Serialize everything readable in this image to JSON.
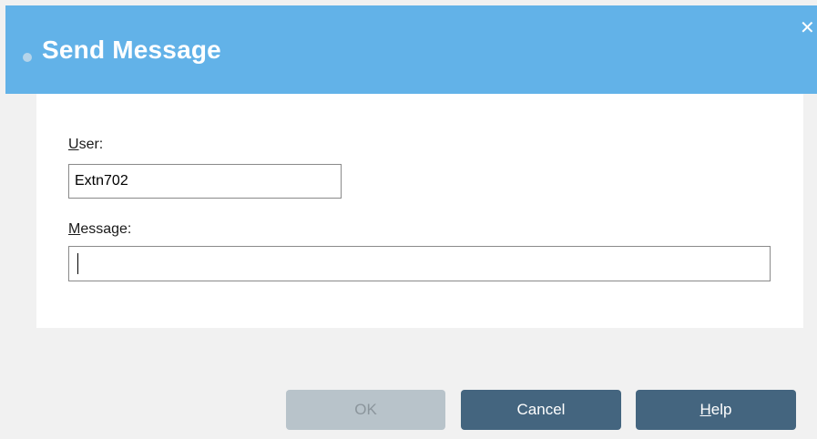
{
  "dialog": {
    "title": "Send Message",
    "close_glyph": "✕"
  },
  "form": {
    "user_label_access": "U",
    "user_label_rest": "ser:",
    "user_value": "Extn702",
    "message_label_access": "M",
    "message_label_rest": "essage:",
    "message_value": ""
  },
  "buttons": {
    "ok_label": "OK",
    "ok_enabled": false,
    "cancel_label": "Cancel",
    "help_label_access": "H",
    "help_label_rest": "elp"
  },
  "colors": {
    "header": "#62b2e8",
    "button_primary": "#44657f",
    "button_disabled": "#b8c3ca"
  },
  "icons": {
    "title_dot": "title-dot-icon",
    "close": "close-icon"
  }
}
